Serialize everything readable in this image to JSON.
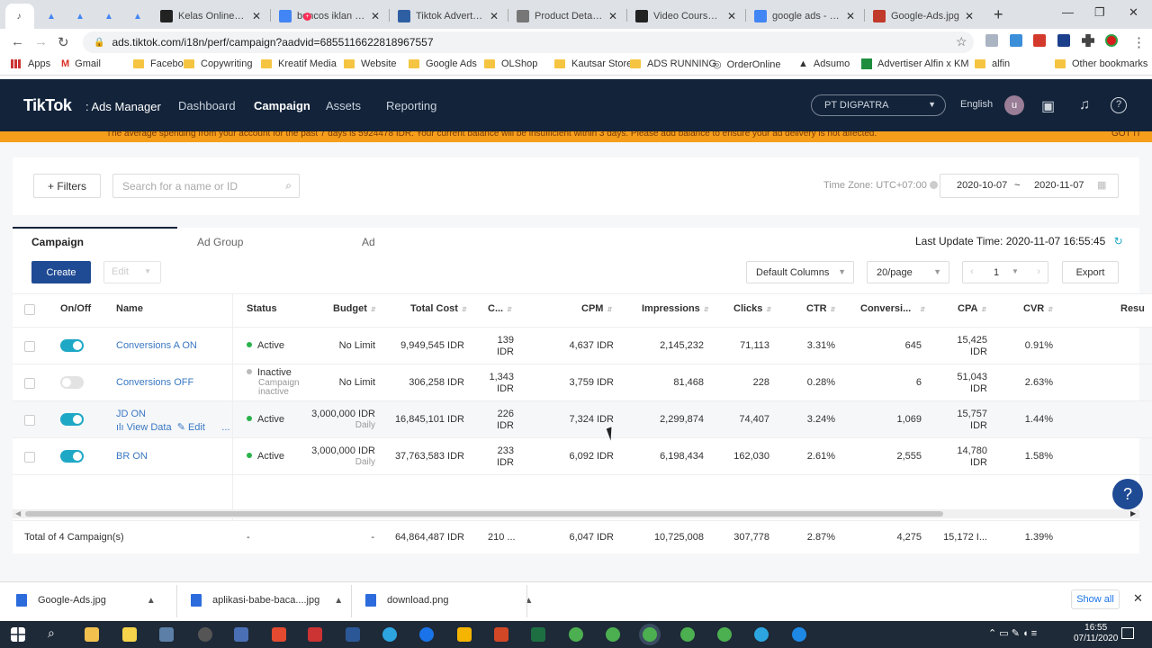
{
  "browser": {
    "tabs": [
      {
        "title": "Kelas Online Belajar",
        "icon": "slack-icon",
        "color": "#222"
      },
      {
        "title": "boncos iklan - Google",
        "icon": "google-icon",
        "color": "#4285f4"
      },
      {
        "title": "Tiktok Advertising",
        "icon": "document-icon",
        "color": "#2e5fa3"
      },
      {
        "title": "Product Details -",
        "icon": "page-icon",
        "color": "#777"
      },
      {
        "title": "Video Course Tiktok",
        "icon": "tiktok-icon",
        "color": "#222"
      },
      {
        "title": "google ads - Google",
        "icon": "google-icon",
        "color": "#4285f4"
      },
      {
        "title": "Google-Ads.jpg",
        "icon": "image-icon",
        "color": "#c0392b"
      }
    ],
    "url": "ads.tiktok.com/i18n/perf/campaign?aadvid=6855116622818967557",
    "bookmarks": [
      "Apps",
      "Gmail",
      "Facebook",
      "Copywriting",
      "Kreatif Media",
      "Website",
      "Google Ads",
      "OLShop",
      "Kautsar Store",
      "ADS RUNNING",
      "OrderOnline",
      "Adsumo",
      "Advertiser Alfin x KM",
      "alfin",
      "Other bookmarks"
    ]
  },
  "header": {
    "logo": "TikTok",
    "logo_sub": ": Ads Manager",
    "nav": [
      "Dashboard",
      "Campaign",
      "Assets",
      "Reporting"
    ],
    "account": "PT DIGPATRA",
    "language": "English",
    "avatar_letter": "u"
  },
  "banner": {
    "text": "The average spending from your account for the past 7 days is 5924478 IDR. Your current balance will be insufficient within 3 days. Please add balance to ensure your ad delivery is not affected.",
    "action": "GOT IT"
  },
  "filters": {
    "filters_label": "+ Filters",
    "search_placeholder": "Search for a name or ID",
    "timezone": "Time Zone: UTC+07:00",
    "date_start": "2020-10-07",
    "date_sep": "~",
    "date_end": "2020-11-07"
  },
  "tabs": [
    "Campaign",
    "Ad Group",
    "Ad"
  ],
  "last_update": "Last Update Time: 2020-11-07 16:55:45",
  "toolbar": {
    "create": "Create",
    "edit": "Edit",
    "columns": "Default Columns",
    "per_page": "20/page",
    "page": "1",
    "export": "Export"
  },
  "columns": [
    "On/Off",
    "Name",
    "Status",
    "Budget",
    "Total Cost",
    "C...",
    "CPM",
    "Impressions",
    "Clicks",
    "CTR",
    "Conversi...",
    "CPA",
    "CVR",
    "Resu"
  ],
  "rows": [
    {
      "on": true,
      "name": "Conversions A ON",
      "status": "Active",
      "status_sub": "",
      "budget": "No Limit",
      "budget_sub": "",
      "cost": "9,949,545 IDR",
      "c1": "139",
      "c2": "IDR",
      "cpm": "4,637 IDR",
      "impressions": "2,145,232",
      "clicks": "71,113",
      "ctr": "3.31%",
      "conversions": "645",
      "cpa1": "15,425",
      "cpa2": "IDR",
      "cvr": "0.91%"
    },
    {
      "on": false,
      "name": "Conversions OFF",
      "status": "Inactive",
      "status_sub": "Campaign inactive",
      "budget": "No Limit",
      "budget_sub": "",
      "cost": "306,258 IDR",
      "c1": "1,343",
      "c2": "IDR",
      "cpm": "3,759 IDR",
      "impressions": "81,468",
      "clicks": "228",
      "ctr": "0.28%",
      "conversions": "6",
      "cpa1": "51,043",
      "cpa2": "IDR",
      "cvr": "2.63%"
    },
    {
      "on": true,
      "name": "JD ON",
      "status": "Active",
      "status_sub": "",
      "budget": "3,000,000 IDR",
      "budget_sub": "Daily",
      "cost": "16,845,101 IDR",
      "c1": "226",
      "c2": "IDR",
      "cpm": "7,324 IDR",
      "impressions": "2,299,874",
      "clicks": "74,407",
      "ctr": "3.24%",
      "conversions": "1,069",
      "cpa1": "15,757",
      "cpa2": "IDR",
      "cvr": "1.44%",
      "row_actions": [
        "View Data",
        "Edit",
        "..."
      ]
    },
    {
      "on": true,
      "name": "BR ON",
      "status": "Active",
      "status_sub": "",
      "budget": "3,000,000 IDR",
      "budget_sub": "Daily",
      "cost": "37,763,583 IDR",
      "c1": "233",
      "c2": "IDR",
      "cpm": "6,092 IDR",
      "impressions": "6,198,434",
      "clicks": "162,030",
      "ctr": "2.61%",
      "conversions": "2,555",
      "cpa1": "14,780",
      "cpa2": "IDR",
      "cvr": "1.58%"
    }
  ],
  "total": {
    "label": "Total of 4 Campaign(s)",
    "status": "-",
    "budget": "-",
    "cost": "64,864,487 IDR",
    "c": "210 ...",
    "cpm": "6,047 IDR",
    "impressions": "10,725,008",
    "clicks": "307,778",
    "ctr": "2.87%",
    "conversions": "4,275",
    "cpa": "15,172 I...",
    "cvr": "1.39%"
  },
  "downloads": [
    "Google-Ads.jpg",
    "aplikasi-babe-baca....jpg",
    "download.png"
  ],
  "show_all": "Show all",
  "clock": {
    "time": "16:55",
    "date": "07/11/2020"
  },
  "colors": {
    "header_bg": "#12233a",
    "banner": "#f59e1c",
    "toggle_on": "#1fa8c6",
    "primary": "#1f4a94",
    "link": "#3a78c2"
  }
}
